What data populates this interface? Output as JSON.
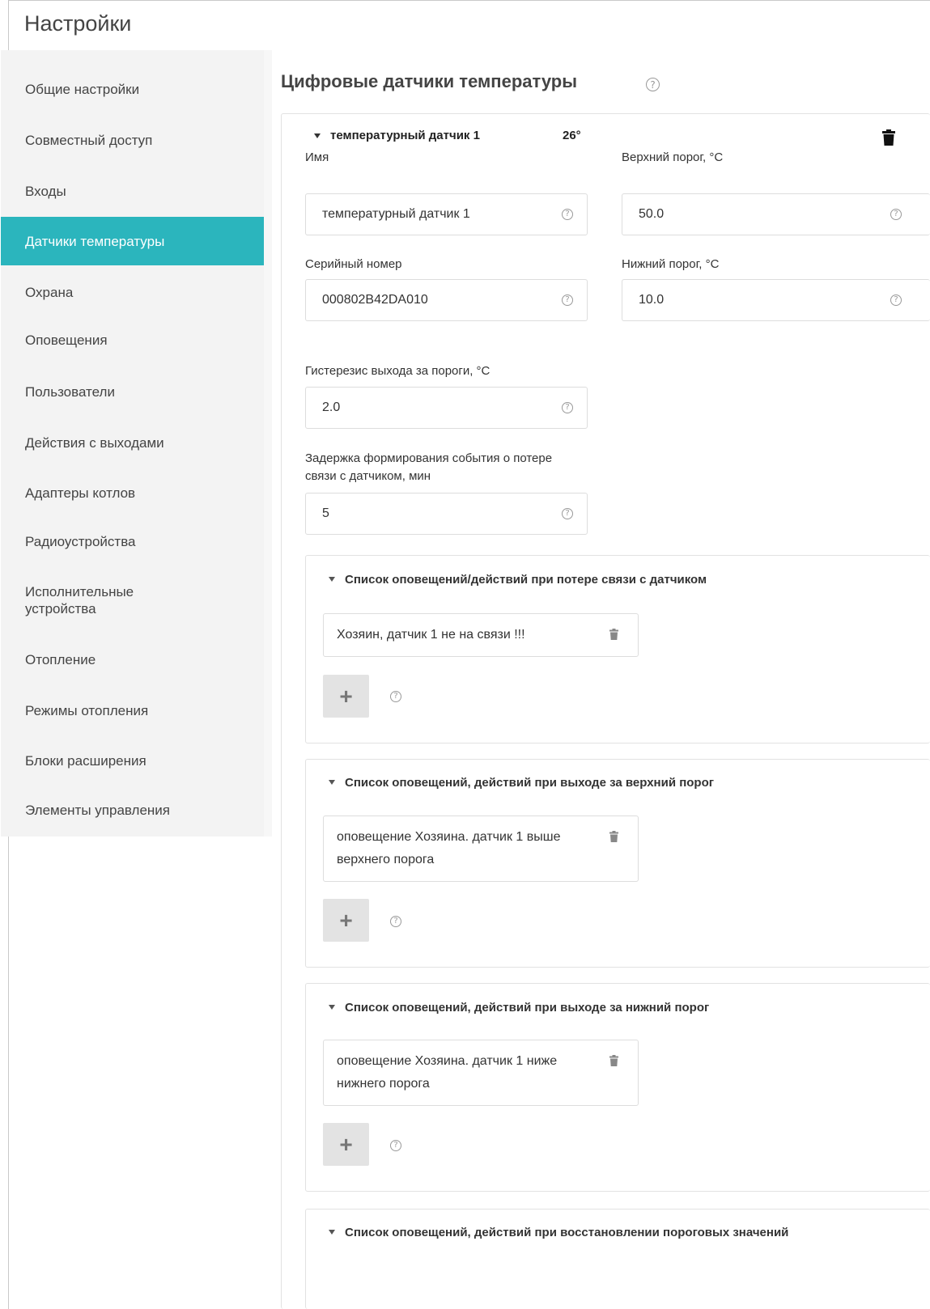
{
  "page": {
    "title": "Настройки"
  },
  "sidebar": {
    "items": [
      {
        "label": "Общие настройки"
      },
      {
        "label": "Совместный доступ"
      },
      {
        "label": "Входы"
      },
      {
        "label": "Датчики температуры",
        "active": true
      },
      {
        "label": "Охрана"
      },
      {
        "label": "Оповещения"
      },
      {
        "label": "Пользователи"
      },
      {
        "label": "Действия с выходами"
      },
      {
        "label": "Адаптеры котлов"
      },
      {
        "label": "Радиоустройства"
      },
      {
        "label": "Исполнительные устройства"
      },
      {
        "label": "Отопление"
      },
      {
        "label": "Режимы отопления"
      },
      {
        "label": "Блоки расширения"
      },
      {
        "label": "Элементы управления"
      }
    ]
  },
  "section": {
    "title": "Цифровые датчики температуры",
    "help_icon": "question-circle-icon"
  },
  "sensor": {
    "name_header": "температурный датчик 1",
    "temperature": "26°",
    "delete_icon": "trash-icon",
    "fields": {
      "name": {
        "label": "Имя",
        "value": "температурный датчик 1"
      },
      "upper": {
        "label": "Верхний порог, °C",
        "value": "50.0"
      },
      "serial": {
        "label": "Серийный номер",
        "value": "000802B42DA010"
      },
      "lower": {
        "label": "Нижний порог, °C",
        "value": "10.0"
      },
      "hysteresis": {
        "label": "Гистерезис выхода за пороги, °C",
        "value": "2.0"
      },
      "delay": {
        "label": "Задержка формирования события о потере связи с датчиком, мин",
        "value": "5"
      }
    },
    "lists": {
      "loss": {
        "title": "Список оповещений/действий при потере связи с датчиком",
        "items": [
          "Хозяин, датчик 1 не на связи !!!"
        ]
      },
      "upper": {
        "title": "Список оповещений, действий при выходе за верхний порог",
        "items": [
          "оповещение Хозяина. датчик 1 выше верхнего порога"
        ]
      },
      "lower": {
        "title": "Список оповещений, действий при выходе за нижний порог",
        "items": [
          "оповещение Хозяина. датчик 1 ниже нижнего порога"
        ]
      },
      "restore": {
        "title": "Список оповещений, действий при восстановлении пороговых значений"
      }
    },
    "add_label": "+",
    "help_glyph": "?"
  },
  "colors": {
    "accent": "#2bb5bd",
    "sidebar_bg": "#f3f3f3",
    "add_button_bg": "#e3e3e3"
  }
}
